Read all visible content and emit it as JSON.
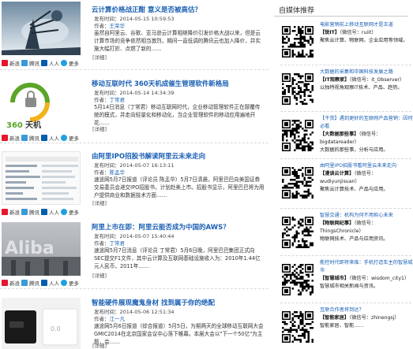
{
  "articles": [
    {
      "title": "云计算价格战正酣 意义是否被高估？",
      "meta_label": "发布时间：",
      "meta_time": "2014-05-15 10:59:53",
      "author_label": "作者：",
      "author": "王荣华",
      "summary": "虽然自阿里云、谷歌、亚马逊云计算相继降价引发价格大战以来，但是云计算市场的竞争依然相当激烈，期间一直低调的腾讯云也加入降价，并实施大幅打折、点燃了新的……",
      "more": "[详细]"
    },
    {
      "title": "移动互联时代 360天机成催生管理软件新格局",
      "meta_label": "发布时间：",
      "meta_time": "2014-05-14 14:34:39",
      "author_label": "作者：",
      "author": "丁常君",
      "summary": "5月14日消息（丁常君）移动互联网时代，企业移动管理软件正在颠覆传统的模式，并走向轻量化和移动化，当企业管理软件的移动应用遍地开花……",
      "more": "[详细]"
    },
    {
      "title": "由阿里IPO招股书解读阿里云未来走向",
      "meta_label": "发布时间：",
      "meta_time": "2014-05-07 16:13:11",
      "author_label": "作者：",
      "author": "陈孟华",
      "summary": "速途网5月7日报道（评论员 陈孟华）5月7日清晨，阿里巴巴向美国证券交易委员会递交IPO招股书，计划赴美上市。招股书显示，阿里巴巴将为用户提供商业和数据技术方面……",
      "more": "[详细]"
    },
    {
      "title": "阿里上市在即：阿里云能否成为中国的AWS？",
      "meta_label": "发布时间：",
      "meta_time": "2014-05-07 15:40:44",
      "author_label": "作者：",
      "author": "丁常君",
      "summary": "速途网5月7日消息（评论员 丁常君）5月6日晚，阿里巴巴集团正式向SEC提交F1文件，其中云计算及互联网基础设施收入为：2010年1.44亿元人民币，2011年……",
      "more": "[详细]"
    },
    {
      "title": "智能硬件展现魔鬼身材 找到属于你的绝配",
      "meta_label": "发布时间：",
      "meta_time": "2014-05-06 12:51:34",
      "author_label": "作者：",
      "author": "江一凡",
      "summary": "速途网5月6日报道（综合报道）5月5日，为期两天的全球移动互联网大会GMIC2014在北京国家会议中心落下帷幕。本届大会以\"下一个50亿\"为主题，会……",
      "more": "[详细]"
    }
  ],
  "share": {
    "sina": "新浪",
    "tencent": "腾讯",
    "renren": "人人",
    "more": "更多"
  },
  "sidebar": {
    "title": "自媒体推荐",
    "items": [
      {
        "headline": "电影营销前上移动互联网才是王道",
        "name": "【锐IT】",
        "handle": "（微信号：ruiit）",
        "desc": "聚焦云计算、物联网、企业应用等领域。"
      },
      {
        "headline": "大数据的采集和中国科技发展之路",
        "name": "【IT观察家】",
        "handle": "（微信号：it_Observer）",
        "desc": "以独特视角观察IT技术、产品、趋势。"
      },
      {
        "headline": "【干货】遇到更好的互联网产品营销：因何必看",
        "name": "【大数据那些事】",
        "handle": "（微信号：bigdatareader）",
        "desc": "大数据的那些事，分析与应用。"
      },
      {
        "headline": "由阿里IPO招股书看阿里云未来走向",
        "name": "【漫谈云计算】",
        "handle": "（微信号：wudiyunjisuan）",
        "desc": "聚焦云计算技术、产品与应用。"
      },
      {
        "headline": "智慧交通：机构为何不用担心未来",
        "name": "【物联网纪事】",
        "handle": "（微信号：ThingsChronicle）",
        "desc": "物联网技术、产品与应用资讯。"
      },
      {
        "headline": "能控时代即将来临：手机打造车主的智慧城市",
        "name": "【智慧城市】",
        "handle": "（微信号：wisdom_city1）",
        "desc": "智慧城市相关新闻与资讯。"
      },
      {
        "headline": "互联合作者将到达？",
        "name": "【智能家居】",
        "handle": "（微信号：zhinengsj）",
        "desc": "智能家居、智能……"
      }
    ]
  },
  "colors": {
    "link": "#1a5fb4",
    "text": "#333333"
  }
}
